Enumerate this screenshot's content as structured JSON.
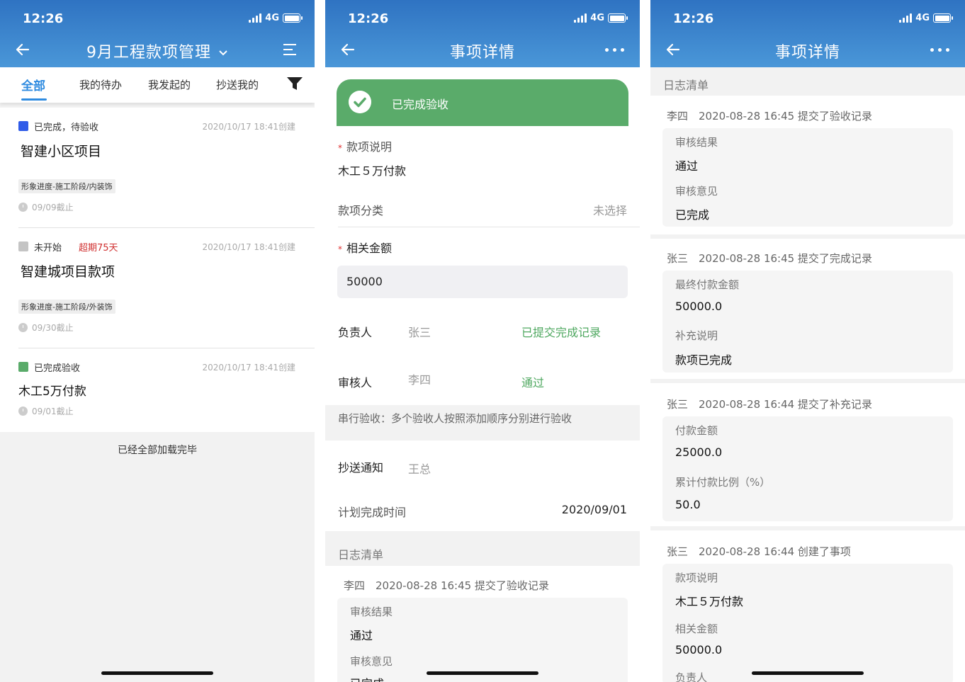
{
  "status": {
    "time": "12:26",
    "network": "4G"
  },
  "screen1": {
    "title": "9月工程款项管理",
    "tabs": [
      "全部",
      "我的待办",
      "我发起的",
      "抄送我的"
    ],
    "cards": [
      {
        "status": "已完成，待验收",
        "status_color": "#2f5be8",
        "overdue": "",
        "created": "2020/10/17 18:41创建",
        "name": "智建小区项目",
        "tag": "形象进度-施工阶段/内装饰",
        "due": "09/09截止"
      },
      {
        "status": "未开始",
        "status_color": "#c4c4c4",
        "overdue": "超期75天",
        "created": "2020/10/17 18:41创建",
        "name": "智建城项目款项",
        "tag": "形象进度-施工阶段/外装饰",
        "due": "09/30截止"
      },
      {
        "status": "已完成验收",
        "status_color": "#5aab6a",
        "overdue": "",
        "created": "2020/10/17 18:41创建",
        "name": "木工5万付款",
        "tag": "",
        "due": "09/01截止"
      }
    ],
    "loaded_text": "已经全部加载完毕"
  },
  "screen2": {
    "title": "事项详情",
    "banner": "已完成验收",
    "desc_label": "款项说明",
    "desc_value": "木工５万付款",
    "category_label": "款项分类",
    "category_value": "未选择",
    "amount_label": "相关金额",
    "amount_value": "50000",
    "owner_label": "负责人",
    "owner_name": "张三",
    "owner_status": "已提交完成记录",
    "reviewer_label": "审核人",
    "reviewer_name": "李四",
    "reviewer_status": "通过",
    "serial_note": "串行验收：多个验收人按照添加顺序分别进行验收",
    "cc_label": "抄送通知",
    "cc_value": "王总",
    "plan_label": "计划完成时间",
    "plan_value": "2020/09/01",
    "log_title": "日志清单",
    "log_head": "李四　2020-08-28 16:45 提交了验收记录",
    "log_fields": [
      {
        "label": "审核结果",
        "value": "通过"
      },
      {
        "label": "审核意见",
        "value": "已完成"
      }
    ]
  },
  "screen3": {
    "title": "事项详情",
    "log_title": "日志清单",
    "entries": [
      {
        "head": "李四　2020-08-28 16:45 提交了验收记录",
        "fields": [
          {
            "label": "审核结果",
            "value": "通过"
          },
          {
            "label": "审核意见",
            "value": "已完成"
          }
        ]
      },
      {
        "head": "张三　2020-08-28 16:45 提交了完成记录",
        "fields": [
          {
            "label": "最终付款金额",
            "value": "50000.0"
          },
          {
            "label": "补充说明",
            "value": "款项已完成"
          }
        ]
      },
      {
        "head": "张三　2020-08-28 16:44 提交了补充记录",
        "fields": [
          {
            "label": "付款金额",
            "value": "25000.0"
          },
          {
            "label": "累计付款比例（%）",
            "value": "50.0"
          }
        ]
      },
      {
        "head": "张三　2020-08-28 16:44 创建了事项",
        "fields": [
          {
            "label": "款项说明",
            "value": "木工５万付款"
          },
          {
            "label": "相关金额",
            "value": "50000.0"
          },
          {
            "label": "负责人",
            "value": ""
          }
        ]
      }
    ]
  }
}
